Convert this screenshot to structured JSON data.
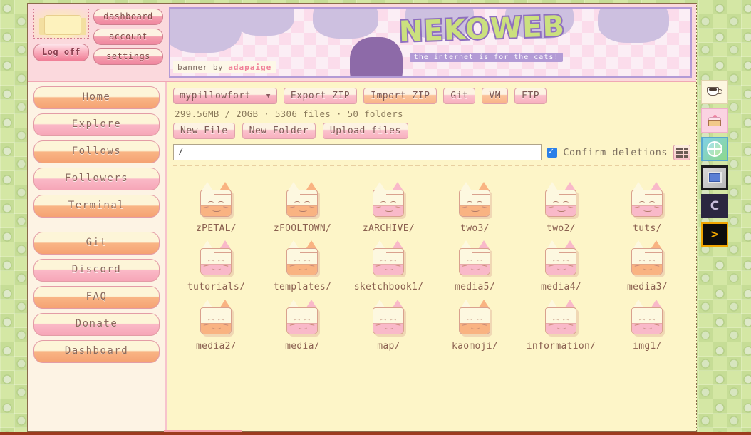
{
  "account": {
    "avatar_name": "user-avatar",
    "logoff_label": "Log off",
    "nav": [
      {
        "label": "dashboard"
      },
      {
        "label": "account"
      },
      {
        "label": "settings"
      }
    ]
  },
  "banner": {
    "logo_text": "NEKOWEB",
    "tagline": "the internet is for the cats!",
    "credit_prefix": "banner by",
    "credit_author": "adapaige"
  },
  "sidebar": {
    "items": [
      {
        "label": "Home",
        "tone": "orange"
      },
      {
        "label": "Explore",
        "tone": "pink"
      },
      {
        "label": "Follows",
        "tone": "orange"
      },
      {
        "label": "Followers",
        "tone": "pink"
      },
      {
        "label": "Terminal",
        "tone": "orange"
      },
      {
        "label": "Git",
        "tone": "orange"
      },
      {
        "label": "Discord",
        "tone": "pink"
      },
      {
        "label": "FAQ",
        "tone": "orange"
      },
      {
        "label": "Donate",
        "tone": "pink"
      },
      {
        "label": "Dashboard",
        "tone": "orange"
      }
    ]
  },
  "filemanager": {
    "site_select": "mypillowfort",
    "caret": "▼",
    "actions": [
      {
        "label": "Export ZIP",
        "tone": "pink"
      },
      {
        "label": "Import ZIP",
        "tone": "warm"
      },
      {
        "label": "Git",
        "tone": "pink"
      },
      {
        "label": "VM",
        "tone": "warm"
      },
      {
        "label": "FTP",
        "tone": "pink"
      }
    ],
    "stats": "299.56MB / 20GB · 5306 files · 50 folders",
    "create_actions": [
      {
        "label": "New File"
      },
      {
        "label": "New Folder"
      },
      {
        "label": "Upload files"
      }
    ],
    "path_value": "/",
    "path_placeholder": "/",
    "confirm_label": "Confirm deletions",
    "confirm_checked": true,
    "view_toggle_name": "grid-view-toggle",
    "files": [
      {
        "name": "zPETAL/",
        "tone": "orange"
      },
      {
        "name": "zFOOLTOWN/",
        "tone": "orange"
      },
      {
        "name": "zARCHIVE/",
        "tone": "pink"
      },
      {
        "name": "two3/",
        "tone": "orange"
      },
      {
        "name": "two2/",
        "tone": "pink"
      },
      {
        "name": "tuts/",
        "tone": "pink"
      },
      {
        "name": "tutorials/",
        "tone": "pink"
      },
      {
        "name": "templates/",
        "tone": "orange"
      },
      {
        "name": "sketchbook1/",
        "tone": "pink"
      },
      {
        "name": "media5/",
        "tone": "pink"
      },
      {
        "name": "media4/",
        "tone": "pink"
      },
      {
        "name": "media3/",
        "tone": "orange"
      },
      {
        "name": "media2/",
        "tone": "orange"
      },
      {
        "name": "media/",
        "tone": "pink"
      },
      {
        "name": "map/",
        "tone": "pink"
      },
      {
        "name": "kaomoji/",
        "tone": "orange"
      },
      {
        "name": "information/",
        "tone": "pink"
      },
      {
        "name": "img1/",
        "tone": "pink"
      }
    ]
  },
  "dock": {
    "items": [
      {
        "icon": "coffee-cup-icon",
        "style": "coffee",
        "glyph": ""
      },
      {
        "icon": "cake-slice-icon",
        "style": "cake",
        "glyph": ""
      },
      {
        "icon": "globe-icon",
        "style": "globe",
        "glyph": ""
      },
      {
        "icon": "window-icon",
        "style": "window",
        "glyph": ""
      },
      {
        "icon": "letter-c-icon",
        "style": "c",
        "glyph": "C"
      },
      {
        "icon": "terminal-prompt-icon",
        "style": "prompt",
        "glyph": ">"
      }
    ]
  }
}
